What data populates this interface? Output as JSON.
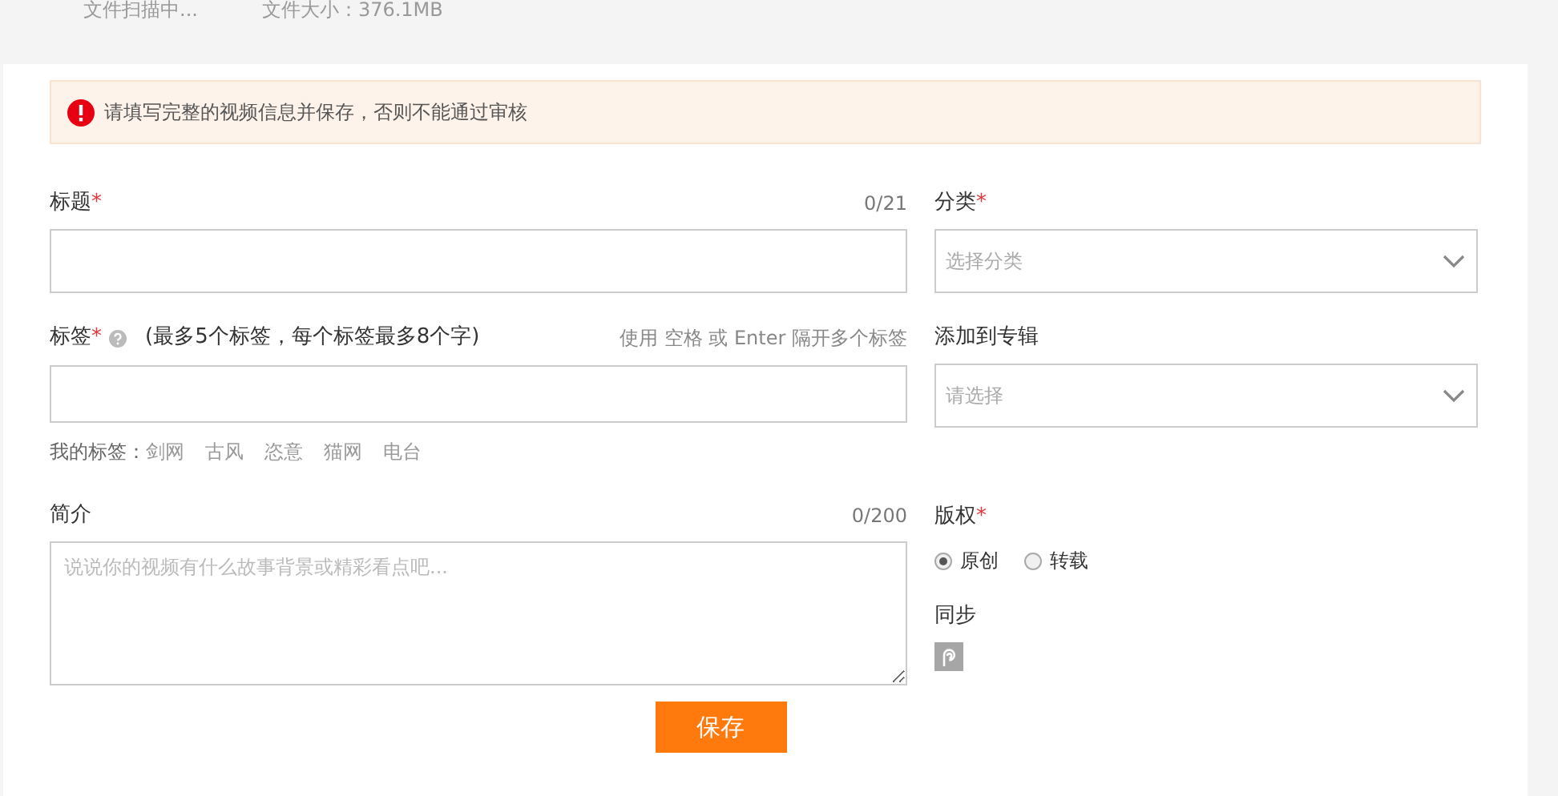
{
  "upload_status": {
    "status": "文件扫描中...",
    "size": "文件大小：376.1MB"
  },
  "notice": {
    "text": "请填写完整的视频信息并保存，否则不能通过审核"
  },
  "title_field": {
    "label": "标题",
    "mark": "*",
    "counter": "0/21"
  },
  "category_field": {
    "label": "分类",
    "mark": "*",
    "placeholder": "选择分类"
  },
  "tags_field": {
    "label": "标签",
    "mark": "*",
    "hint": "(最多5个标签，每个标签最多8个字)",
    "tip": "使用 空格 或 Enter 隔开多个标签"
  },
  "my_tags": {
    "label": "我的标签：",
    "items": [
      "剑网",
      "古风",
      "恣意",
      "猫网",
      "电台"
    ]
  },
  "album_field": {
    "label": "添加到专辑",
    "placeholder": "请选择"
  },
  "intro_field": {
    "label": "简介",
    "counter": "0/200",
    "placeholder": "说说你的视频有什么故事背景或精彩看点吧..."
  },
  "copyright": {
    "label": "版权",
    "mark": "*",
    "options": [
      {
        "label": "原创",
        "selected": true
      },
      {
        "label": "转载",
        "selected": false
      }
    ]
  },
  "sync": {
    "label": "同步"
  },
  "save_button": {
    "label": "保存"
  }
}
